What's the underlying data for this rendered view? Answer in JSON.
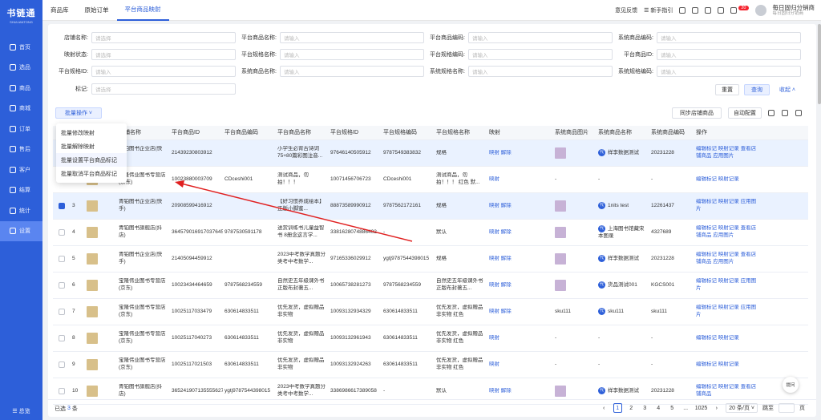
{
  "app": {
    "logo_title": "书链通",
    "logo_sub": "SHULIANTONG"
  },
  "sidebar": {
    "items": [
      {
        "label": "首页",
        "icon": "home-icon"
      },
      {
        "label": "选品",
        "icon": "select-icon"
      },
      {
        "label": "商品",
        "icon": "goods-icon"
      },
      {
        "label": "商城",
        "icon": "mall-icon"
      },
      {
        "label": "订单",
        "icon": "order-icon"
      },
      {
        "label": "售后",
        "icon": "aftersale-icon"
      },
      {
        "label": "客户",
        "icon": "customer-icon"
      },
      {
        "label": "结算",
        "icon": "settle-icon"
      },
      {
        "label": "统计",
        "icon": "stats-icon"
      },
      {
        "label": "设置",
        "icon": "settings-icon",
        "active": true
      }
    ],
    "bottom_label": "总览"
  },
  "header": {
    "tabs": [
      "商品库",
      "原始订单",
      "平台商品映射"
    ],
    "active_tab": 2,
    "feedback": "意见反馈",
    "guide": "新手指引",
    "badge": "20",
    "user_name": "每日固归分销商",
    "user_sub": "每日固归分销商"
  },
  "filters": {
    "row1": [
      {
        "label": "店铺名称:",
        "placeholder": "请选择"
      },
      {
        "label": "平台商品名称:",
        "placeholder": "请输入"
      },
      {
        "label": "平台商品编码:",
        "placeholder": "请输入"
      },
      {
        "label": "系统商品编码:",
        "placeholder": "请输入"
      }
    ],
    "row2": [
      {
        "label": "映射状态:",
        "placeholder": "请选择"
      },
      {
        "label": "平台规格名称:",
        "placeholder": "请输入"
      },
      {
        "label": "平台规格编码:",
        "placeholder": "请输入"
      },
      {
        "label": "平台商品ID:",
        "placeholder": "请输入"
      }
    ],
    "row3": [
      {
        "label": "平台规格ID:",
        "placeholder": "请输入"
      },
      {
        "label": "系统商品名称:",
        "placeholder": "请输入"
      },
      {
        "label": "系统规格名称:",
        "placeholder": "请输入"
      },
      {
        "label": "系统规格编码:",
        "placeholder": "请输入"
      }
    ],
    "row4": [
      {
        "label": "标记:",
        "placeholder": "请选择"
      }
    ],
    "reset": "重置",
    "search": "查询",
    "collapse": "收起"
  },
  "toolbar": {
    "batch_label": "批量操作",
    "sync_label": "同步店铺商品",
    "auto_label": "自动配置"
  },
  "dropdown": {
    "items": [
      "批量修改映射",
      "批量解除映射",
      "批量设置平台商品标记",
      "批量取消平台商品标记"
    ]
  },
  "table": {
    "headers": [
      "",
      "",
      "片",
      "店铺名称",
      "平台商品ID",
      "平台商品编码",
      "平台商品名称",
      "平台规格ID",
      "平台规格编码",
      "平台规格名称",
      "映射",
      "系统商品图片",
      "系统商品名称",
      "系统商品编码",
      "操作"
    ],
    "rows": [
      {
        "idx": "",
        "checked": false,
        "sel": true,
        "shop": "青铂图书企业店(快手)",
        "pid": "21439230803912",
        "pcode": "",
        "pname": "小学生必背古诗词75+80篇彩图注音...",
        "sid": "97646140505912",
        "scode": "9787549383832",
        "sname": "规格",
        "map": "映射 解除",
        "simg": true,
        "sysname": "样李数据测试",
        "syscode": "20231228",
        "ops": "编辑标记 映射记录 查看店铺商品 应用图片"
      },
      {
        "idx": "2",
        "checked": true,
        "sel": false,
        "shop": "宝隆伟业图书专营店(京东)",
        "pid": "10023880003709",
        "pcode": "CDceshi001",
        "pname": "测试商品，勿拍！！！",
        "sid": "10071456706723",
        "scode": "CDceshi001",
        "sname": "测试商品，勿拍！！！ 红色 默...",
        "map": "映射",
        "simg": false,
        "sysname": "-",
        "syscode": "-",
        "ops": "编辑标记 映射记录"
      },
      {
        "idx": "3",
        "checked": true,
        "sel": true,
        "shop": "青铂图书企业店(快手)",
        "pid": "20908599416912",
        "pcode": "",
        "pname": "【好习惯养成绘本】正版小脚蜜...",
        "sid": "88873589990912",
        "scode": "9787562172161",
        "sname": "规格",
        "map": "映射 解除",
        "simg": true,
        "sysname": "1nits test",
        "syscode": "12261437",
        "ops": "编辑标记 映射记录 应用图片"
      },
      {
        "idx": "4",
        "checked": false,
        "sel": false,
        "shop": "青铂图书旗舰店(抖店)",
        "pid": "3645790169170376456",
        "pcode": "9787530591178",
        "pname": "送赏训练书儿童益智书 8册念这言学...",
        "sid": "3381628074886402",
        "scode": "-",
        "sname": "默认",
        "map": "映射 解除",
        "simg": true,
        "sysname": "上海图书馆藏宋本图录",
        "syscode": "4327689",
        "ops": "编辑标记 映射记录 查看店铺商品 应用图片"
      },
      {
        "idx": "5",
        "checked": false,
        "sel": false,
        "shop": "青铂图书企业店(快手)",
        "pid": "21405094459912",
        "pcode": "",
        "pname": "2023中考数学真题分类考中考数学...",
        "sid": "97165336029912",
        "scode": "ygtj9787544398015",
        "sname": "规格",
        "map": "映射 解除",
        "simg": true,
        "sysname": "样李数据测试",
        "syscode": "20231228",
        "ops": "编辑标记 映射记录 查看店铺商品 应用图片"
      },
      {
        "idx": "6",
        "checked": false,
        "sel": false,
        "shop": "宝隆伟业图书专营店(京东)",
        "pid": "10023434464659",
        "pcode": "9787568234559",
        "pname": "自然史五年级课外书正版布封著五...",
        "sid": "10065738281273",
        "scode": "9787568234559",
        "sname": "自然史五年级课外书正版布封著五...",
        "map": "映射 解除",
        "simg": true,
        "sysname": "货品测试001",
        "syscode": "KGCS001",
        "ops": "编辑标记 映射记录 应用图片"
      },
      {
        "idx": "7",
        "checked": false,
        "sel": false,
        "shop": "宝隆伟业图书专营店(京东)",
        "pid": "10025117033479",
        "pcode": "630614833511",
        "pname": "优先发货，虚拟赠品非实物",
        "sid": "10093132934329",
        "scode": "630614833511",
        "sname": "优先发货，虚拟赠品非实物 红色",
        "map": "映射 解除",
        "simg": false,
        "sysname": "sku111",
        "syscode": "sku111",
        "ops": "编辑标记 映射记录 应用图片"
      },
      {
        "idx": "8",
        "checked": false,
        "sel": false,
        "shop": "宝隆伟业图书专营店(京东)",
        "pid": "10025117040273",
        "pcode": "630614833511",
        "pname": "优先发货，虚拟赠品非实物",
        "sid": "10093132961943",
        "scode": "630614833511",
        "sname": "优先发货，虚拟赠品非实物 红色",
        "map": "映射",
        "simg": false,
        "sysname": "-",
        "syscode": "-",
        "ops": "编辑标记 映射记录"
      },
      {
        "idx": "9",
        "checked": false,
        "sel": false,
        "shop": "宝隆伟业图书专营店(京东)",
        "pid": "10025117021503",
        "pcode": "630614833511",
        "pname": "优先发货，虚拟赠品非实物",
        "sid": "10093132924263",
        "scode": "630614833511",
        "sname": "优先发货，虚拟赠品非实物 红色",
        "map": "映射",
        "simg": false,
        "sysname": "-",
        "syscode": "-",
        "ops": "编辑标记 映射记录"
      },
      {
        "idx": "10",
        "checked": false,
        "sel": false,
        "shop": "青铂图书旗舰店(抖店)",
        "pid": "3652419071355556275",
        "pcode": "ygtj9787544398015",
        "pname": "2023中考数学真题分类考中考数学...",
        "sid": "3386986617389058",
        "scode": "-",
        "sname": "默认",
        "map": "映射 解除",
        "simg": true,
        "sysname": "样李数据测试",
        "syscode": "20231228",
        "ops": "编辑标记 映射记录 查看店铺商品"
      }
    ]
  },
  "footer": {
    "selected_prefix": "已选",
    "selected_count": "3",
    "selected_suffix": "条",
    "pages": [
      "1",
      "2",
      "3",
      "4",
      "5",
      "...",
      "1025"
    ],
    "page_size": "20 条/页",
    "goto": "跳至",
    "page_unit": "页"
  },
  "float_label": "提问",
  "colors": {
    "primary": "#2d5fd9",
    "sidebar": "#2d5fd9",
    "arrow": "#e02020"
  }
}
